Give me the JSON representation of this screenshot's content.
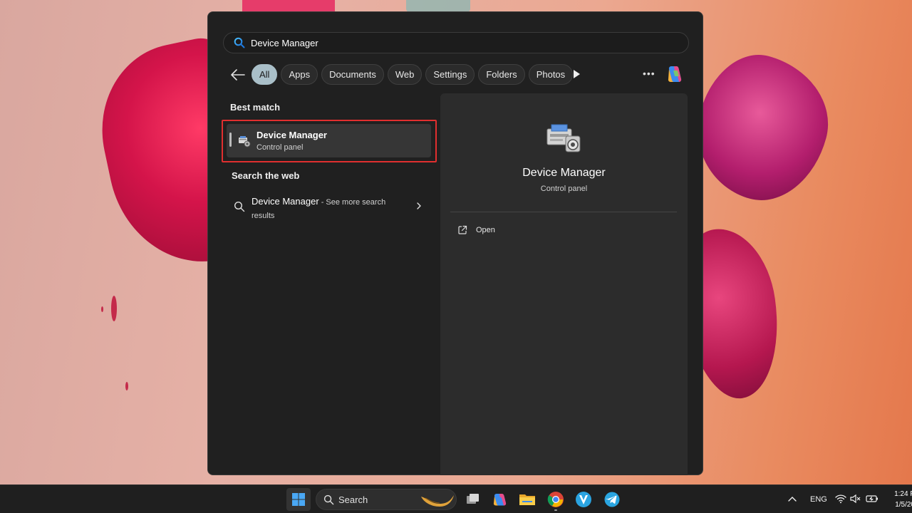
{
  "search": {
    "query": "Device Manager"
  },
  "filters": {
    "chips": [
      "All",
      "Apps",
      "Documents",
      "Web",
      "Settings",
      "Folders",
      "Photos"
    ],
    "active": "All"
  },
  "results": {
    "best_match_title": "Best match",
    "best_match": {
      "name": "Device Manager",
      "type": "Control panel"
    },
    "web_title": "Search the web",
    "web_item": {
      "name": "Device Manager",
      "suffix": " - See more search",
      "suffix2": "results"
    }
  },
  "preview": {
    "name": "Device Manager",
    "type": "Control panel",
    "actions": {
      "open_label": "Open"
    }
  },
  "taskbar": {
    "search_label": "Search",
    "lang": "ENG",
    "time": "1:24 P",
    "date": "1/5/20"
  },
  "colors": {
    "highlight_border": "#e12f2f",
    "active_chip": "#a9bfc8",
    "panel_bg": "#202020",
    "preview_bg": "#2c2c2c"
  }
}
